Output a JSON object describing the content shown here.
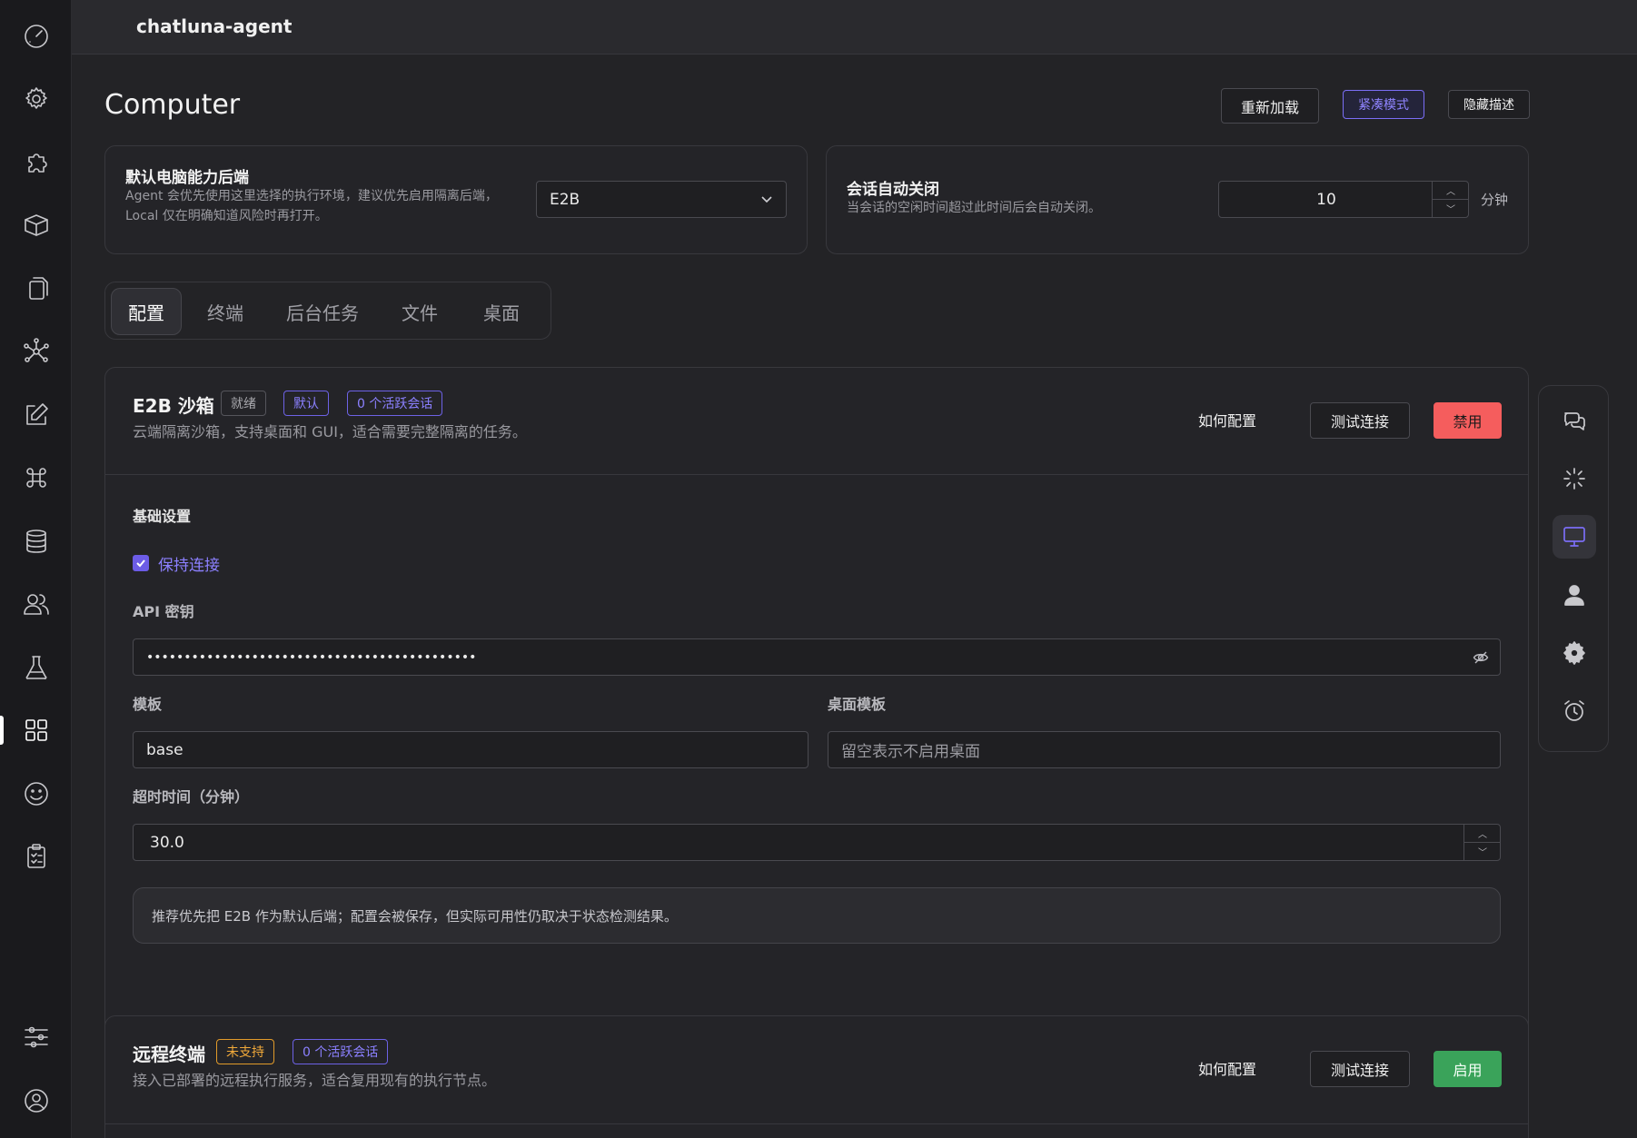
{
  "app": {
    "title": "chatluna-agent"
  },
  "page": {
    "title": "Computer",
    "actions": {
      "reload": "重新加载",
      "compact": "紧凑模式",
      "hide_desc": "隐藏描述"
    }
  },
  "backend_card": {
    "label": "默认电脑能力后端",
    "description": "Agent 会优先使用这里选择的执行环境，建议优先启用隔离后端， Local 仅在明确知道风险时再打开。",
    "selected": "E2B"
  },
  "session_card": {
    "label": "会话自动关闭",
    "description": "当会话的空闲时间超过此时间后会自动关闭。",
    "value": "10",
    "unit": "分钟"
  },
  "tabs": [
    {
      "label": "配置",
      "active": true
    },
    {
      "label": "终端",
      "active": false
    },
    {
      "label": "后台任务",
      "active": false
    },
    {
      "label": "文件",
      "active": false
    },
    {
      "label": "桌面",
      "active": false
    }
  ],
  "e2b": {
    "title": "E2B 沙箱",
    "badges": {
      "status": "就绪",
      "default": "默认",
      "sessions": "0 个活跃会话"
    },
    "description": "云端隔离沙箱，支持桌面和 GUI，适合需要完整隔离的任务。",
    "actions": {
      "howto": "如何配置",
      "test": "测试连接",
      "toggle": "禁用"
    },
    "section_title": "基础设置",
    "keep_alive_label": "保持连接",
    "api_key_label": "API 密钥",
    "api_key_value": "••••••••••••••••••••••••••••••••••••••••••••",
    "template_label": "模板",
    "template_value": "base",
    "desktop_template_label": "桌面模板",
    "desktop_template_placeholder": "留空表示不启用桌面",
    "timeout_label": "超时时间（分钟）",
    "timeout_value": "30.0",
    "note": "推荐优先把 E2B 作为默认后端；配置会被保存，但实际可用性仍取决于状态检测结果。"
  },
  "remote": {
    "title": "远程终端",
    "badges": {
      "status": "未支持",
      "sessions": "0 个活跃会话"
    },
    "description": "接入已部署的远程执行服务，适合复用现有的执行节点。",
    "actions": {
      "howto": "如何配置",
      "test": "测试连接",
      "toggle": "启用"
    }
  },
  "colors": {
    "accent": "#7b6ef6",
    "danger": "#f55d5d",
    "success": "#3aa35a",
    "warning": "#e29b2a"
  }
}
